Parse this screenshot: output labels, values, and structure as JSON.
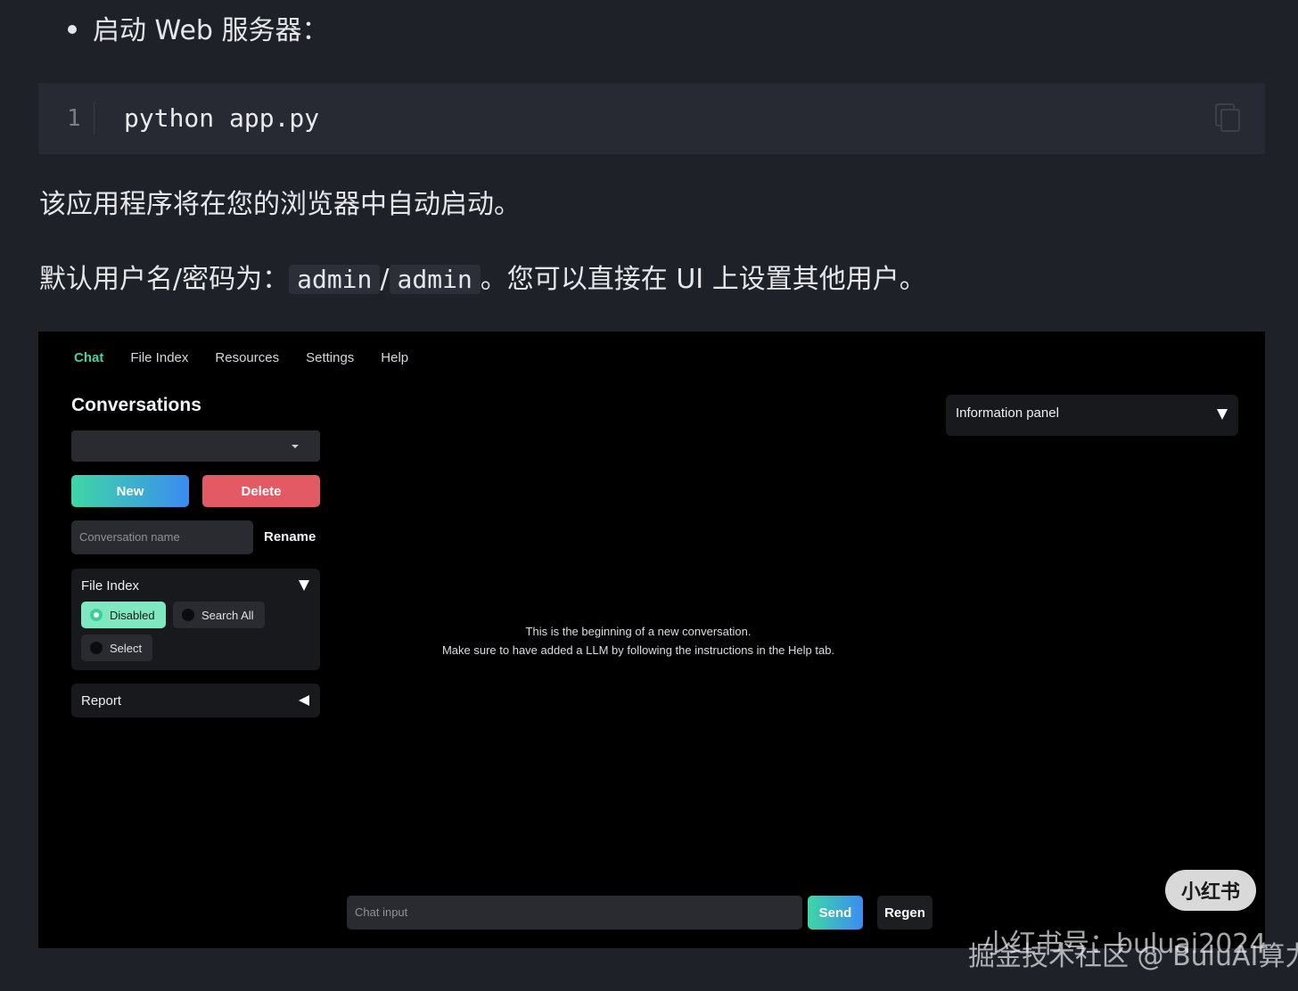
{
  "article": {
    "bullet": "启动 Web 服务器：",
    "code": {
      "line_number": "1",
      "text": "python app.py",
      "copy_icon": "copy-icon"
    },
    "para1": "该应用程序将在您的浏览器中自动启动。",
    "para2": {
      "prefix": "默认用户名/密码为：",
      "username": "admin",
      "slash": "/",
      "password": "admin",
      "suffix": "。您可以直接在 UI 上设置其他用户。"
    }
  },
  "app": {
    "tabs": [
      {
        "label": "Chat",
        "active": true
      },
      {
        "label": "File Index",
        "active": false
      },
      {
        "label": "Resources",
        "active": false
      },
      {
        "label": "Settings",
        "active": false
      },
      {
        "label": "Help",
        "active": false
      }
    ],
    "sidebar": {
      "title": "Conversations",
      "conversation_select": {
        "value": ""
      },
      "new_label": "New",
      "delete_label": "Delete",
      "conversation_name_placeholder": "Conversation name",
      "rename_label": "Rename",
      "file_index": {
        "title": "File Index",
        "options": [
          {
            "label": "Disabled",
            "selected": true
          },
          {
            "label": "Search All",
            "selected": false
          },
          {
            "label": "Select",
            "selected": false
          }
        ]
      },
      "report": {
        "title": "Report"
      }
    },
    "info_panel": {
      "title": "Information panel"
    },
    "message": {
      "line1": "This is the beginning of a new conversation.",
      "line2": "Make sure to have added a LLM by following the instructions in the Help tab."
    },
    "chat": {
      "input_placeholder": "Chat input",
      "send_label": "Send",
      "regen_label": "Regen"
    }
  },
  "overlay": {
    "badge": "小红书",
    "watermark_top": "小红书号：buluai2024",
    "watermark_bottom": "掘金技术社区 @ BuluAI算力云"
  },
  "colors": {
    "page_bg": "#1f2129",
    "app_bg": "#000000",
    "accent_green": "#3ed4a0",
    "delete_red": "#e35a65",
    "gradient_blue": "#3b8cf0"
  }
}
